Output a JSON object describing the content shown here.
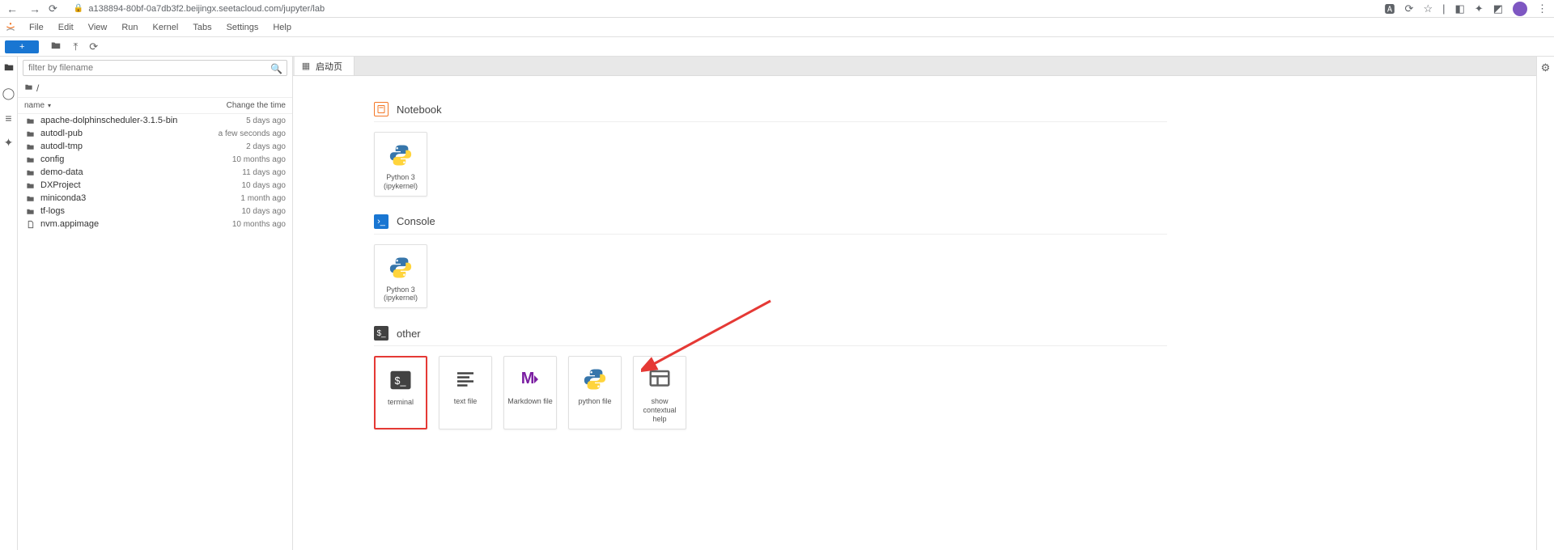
{
  "browser": {
    "url": "a138894-80bf-0a7db3f2.beijingx.seetacloud.com/jupyter/lab"
  },
  "menus": [
    "File",
    "Edit",
    "View",
    "Run",
    "Kernel",
    "Tabs",
    "Settings",
    "Help"
  ],
  "toolbar": {
    "new_label": "+"
  },
  "filebrowser": {
    "filter_placeholder": "filter by filename",
    "crumb": "/",
    "head_name": "name",
    "head_time": "Change the time",
    "items": [
      {
        "icon": "folder",
        "name": "apache-dolphinscheduler-3.1.5-bin",
        "time": "5 days ago"
      },
      {
        "icon": "folder",
        "name": "autodl-pub",
        "time": "a few seconds ago"
      },
      {
        "icon": "folder",
        "name": "autodl-tmp",
        "time": "2 days ago"
      },
      {
        "icon": "folder",
        "name": "config",
        "time": "10 months ago"
      },
      {
        "icon": "folder",
        "name": "demo-data",
        "time": "11 days ago"
      },
      {
        "icon": "folder",
        "name": "DXProject",
        "time": "10 days ago"
      },
      {
        "icon": "folder",
        "name": "miniconda3",
        "time": "1 month ago"
      },
      {
        "icon": "folder",
        "name": "tf-logs",
        "time": "10 days ago"
      },
      {
        "icon": "file",
        "name": "nvm.appimage",
        "time": "10 months ago"
      }
    ]
  },
  "tabs": {
    "launcher_label": "启动页"
  },
  "launcher": {
    "notebook": {
      "title": "Notebook",
      "kernel_label": "Python 3 (ipykernel)"
    },
    "console": {
      "title": "Console",
      "kernel_label": "Python 3 (ipykernel)"
    },
    "other": {
      "title": "other",
      "cards": [
        {
          "id": "terminal",
          "label": "terminal",
          "highlight": true
        },
        {
          "id": "text",
          "label": "text file"
        },
        {
          "id": "markdown",
          "label": "Markdown file"
        },
        {
          "id": "python",
          "label": "python file"
        },
        {
          "id": "contextual",
          "label": "show contextual help"
        }
      ]
    }
  }
}
